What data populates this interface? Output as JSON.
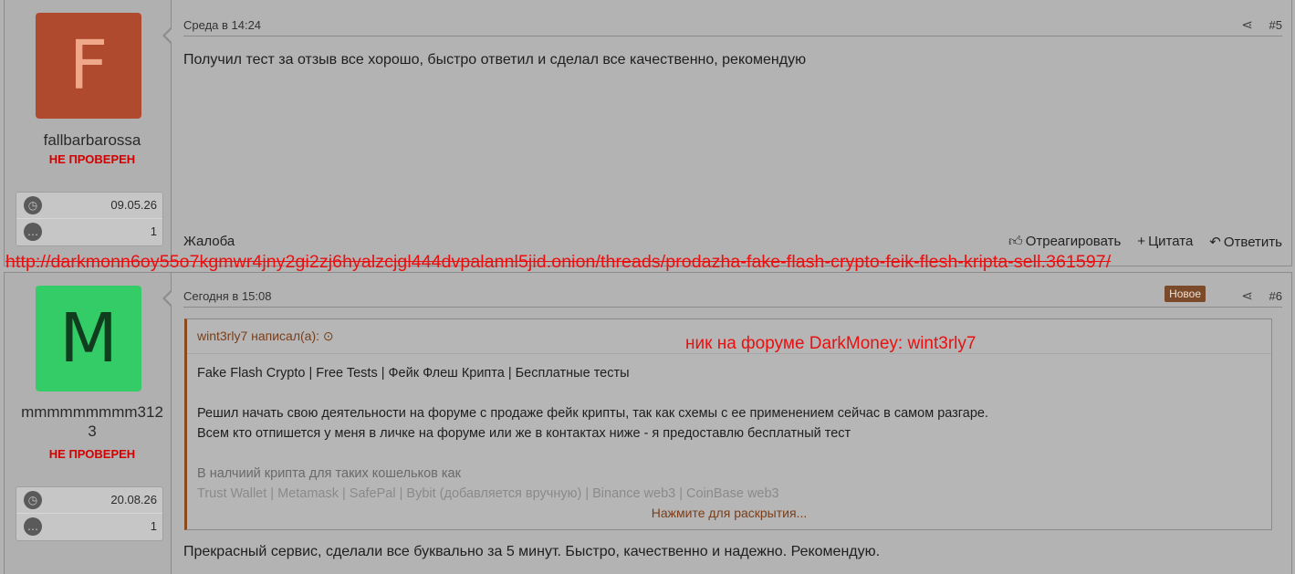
{
  "url_overlay": "http://darkmonn6oy55o7kgmwr4jny2gi2zj6hyalzcjgl444dvpalannl5jid.onion/threads/prodazha-fake-flash-crypto-feik-flesh-kripta-sell.361597/",
  "colors": {
    "avatar1_bg": "#b04a2e",
    "avatar1_fg": "#f0a88a",
    "avatar2_bg": "#33cc66",
    "avatar2_fg": "#0f3d1e",
    "accent_red": "#e81010"
  },
  "posts": [
    {
      "avatar_letter": "F",
      "username": "fallbarbarossa",
      "badge": "НЕ ПРОВЕРЕН",
      "joined": "09.05.26",
      "messages": "1",
      "date": "Среда в 14:24",
      "number": "#5",
      "message": "Получил тест за отзыв все хорошо, быстро ответил и сделал все качественно, рекомендую",
      "actions": {
        "report": "Жалоба",
        "react": "Отреагировать",
        "quote": "Цитата",
        "reply": "Ответить"
      }
    },
    {
      "avatar_letter": "M",
      "username_line1": "mmmmmmmmm312",
      "username_line2": "3",
      "badge": "НЕ ПРОВЕРЕН",
      "joined": "20.08.26",
      "messages": "1",
      "date": "Сегодня в 15:08",
      "new_label": "Новое",
      "number": "#6",
      "quote": {
        "author": "wint3rly7 написал(а):",
        "nick_note": "ник на форуме DarkMoney: wint3rly7",
        "line1": "Fake Flash Crypto | Free Tests | Фейк Флеш Крипта | Бесплатные тесты",
        "line2": "Решил начать свою деятельности на форуме с продаже фейк крипты, так как схемы с ее применением сейчас в самом разгаре.",
        "line3": "Всем кто отпишется у меня в личке на форуме или же в контактах ниже - я предоставлю бесплатный тест",
        "line4": "В налчиий крипта для таких кошельков как",
        "line5": "Trust Wallet | Metamask | SafePal | Bybit (добавляется вручную) | Binance web3 | CoinBase web3",
        "expand": "Нажмите для раскрытия..."
      },
      "message": "Прекрасный сервис, сделали все буквально за 5 минут. Быстро, качественно и надежно. Рекомендую."
    }
  ]
}
